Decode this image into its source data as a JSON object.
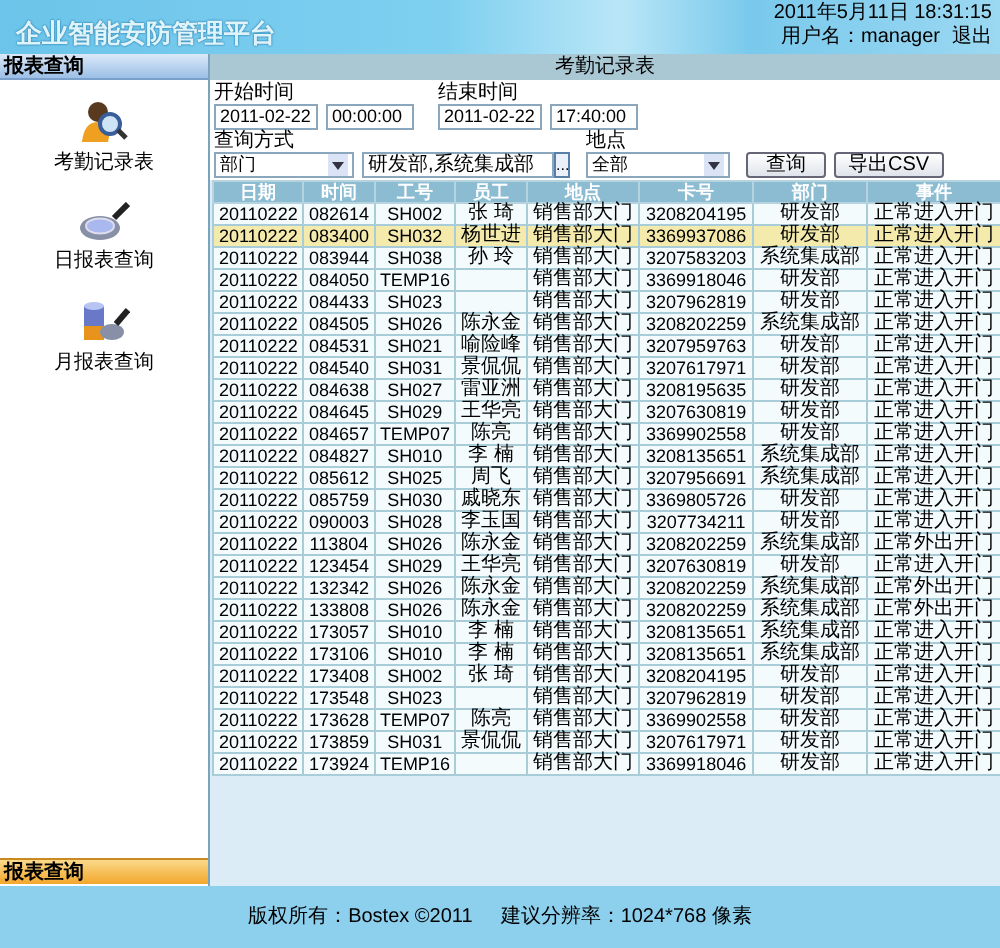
{
  "header": {
    "title": "企业智能安防管理平台",
    "datetime": "2011年5月11日  18:31:15",
    "user": "用户名：manager",
    "logout": "退出"
  },
  "sidebar": {
    "title": "报表查询",
    "items": [
      {
        "label": "考勤记录表",
        "kind": "attendance"
      },
      {
        "label": "日报表查询",
        "kind": "daily"
      },
      {
        "label": "月报表查询",
        "kind": "monthly"
      }
    ],
    "bottom_section": "报表查询"
  },
  "main": {
    "title": "考勤记录表",
    "filters": {
      "start_label": "开始时间",
      "start_date": "2011-02-22",
      "start_time": "00:00:00",
      "end_label": "结束时间",
      "end_date": "2011-02-22",
      "end_time": "17:40:00",
      "mode_label": "查询方式",
      "mode": "部门",
      "departments": "研发部,系统集成部",
      "picker_button": "...",
      "location_label": "地点",
      "location": "全部",
      "query_button": "查询",
      "export_button": "导出CSV"
    },
    "table": {
      "columns": [
        "日期",
        "时间",
        "工号",
        "员工",
        "地点",
        "卡号",
        "部门",
        "事件"
      ],
      "rows": [
        {
          "selected": false,
          "cells": [
            "20110222",
            "082614",
            "SH002",
            "张 琦",
            "销售部大门",
            "3208204195",
            "研发部",
            "正常进入开门"
          ]
        },
        {
          "selected": true,
          "cells": [
            "20110222",
            "083400",
            "SH032",
            "杨世进",
            "销售部大门",
            "3369937086",
            "研发部",
            "正常进入开门"
          ]
        },
        {
          "selected": false,
          "cells": [
            "20110222",
            "083944",
            "SH038",
            "孙 玲",
            "销售部大门",
            "3207583203",
            "系统集成部",
            "正常进入开门"
          ]
        },
        {
          "selected": false,
          "cells": [
            "20110222",
            "084050",
            "TEMP16",
            "",
            "销售部大门",
            "3369918046",
            "研发部",
            "正常进入开门"
          ]
        },
        {
          "selected": false,
          "cells": [
            "20110222",
            "084433",
            "SH023",
            "",
            "销售部大门",
            "3207962819",
            "研发部",
            "正常进入开门"
          ]
        },
        {
          "selected": false,
          "cells": [
            "20110222",
            "084505",
            "SH026",
            "陈永金",
            "销售部大门",
            "3208202259",
            "系统集成部",
            "正常进入开门"
          ]
        },
        {
          "selected": false,
          "cells": [
            "20110222",
            "084531",
            "SH021",
            "喻险峰",
            "销售部大门",
            "3207959763",
            "研发部",
            "正常进入开门"
          ]
        },
        {
          "selected": false,
          "cells": [
            "20110222",
            "084540",
            "SH031",
            "景侃侃",
            "销售部大门",
            "3207617971",
            "研发部",
            "正常进入开门"
          ]
        },
        {
          "selected": false,
          "cells": [
            "20110222",
            "084638",
            "SH027",
            "雷亚洲",
            "销售部大门",
            "3208195635",
            "研发部",
            "正常进入开门"
          ]
        },
        {
          "selected": false,
          "cells": [
            "20110222",
            "084645",
            "SH029",
            "王华亮",
            "销售部大门",
            "3207630819",
            "研发部",
            "正常进入开门"
          ]
        },
        {
          "selected": false,
          "cells": [
            "20110222",
            "084657",
            "TEMP07",
            "陈亮",
            "销售部大门",
            "3369902558",
            "研发部",
            "正常进入开门"
          ]
        },
        {
          "selected": false,
          "cells": [
            "20110222",
            "084827",
            "SH010",
            "李 楠",
            "销售部大门",
            "3208135651",
            "系统集成部",
            "正常进入开门"
          ]
        },
        {
          "selected": false,
          "cells": [
            "20110222",
            "085612",
            "SH025",
            "周飞",
            "销售部大门",
            "3207956691",
            "系统集成部",
            "正常进入开门"
          ]
        },
        {
          "selected": false,
          "cells": [
            "20110222",
            "085759",
            "SH030",
            "戚晓东",
            "销售部大门",
            "3369805726",
            "研发部",
            "正常进入开门"
          ]
        },
        {
          "selected": false,
          "cells": [
            "20110222",
            "090003",
            "SH028",
            "李玉国",
            "销售部大门",
            "3207734211",
            "研发部",
            "正常进入开门"
          ]
        },
        {
          "selected": false,
          "cells": [
            "20110222",
            "113804",
            "SH026",
            "陈永金",
            "销售部大门",
            "3208202259",
            "系统集成部",
            "正常外出开门"
          ]
        },
        {
          "selected": false,
          "cells": [
            "20110222",
            "123454",
            "SH029",
            "王华亮",
            "销售部大门",
            "3207630819",
            "研发部",
            "正常进入开门"
          ]
        },
        {
          "selected": false,
          "cells": [
            "20110222",
            "132342",
            "SH026",
            "陈永金",
            "销售部大门",
            "3208202259",
            "系统集成部",
            "正常外出开门"
          ]
        },
        {
          "selected": false,
          "cells": [
            "20110222",
            "133808",
            "SH026",
            "陈永金",
            "销售部大门",
            "3208202259",
            "系统集成部",
            "正常外出开门"
          ]
        },
        {
          "selected": false,
          "cells": [
            "20110222",
            "173057",
            "SH010",
            "李 楠",
            "销售部大门",
            "3208135651",
            "系统集成部",
            "正常进入开门"
          ]
        },
        {
          "selected": false,
          "cells": [
            "20110222",
            "173106",
            "SH010",
            "李 楠",
            "销售部大门",
            "3208135651",
            "系统集成部",
            "正常进入开门"
          ]
        },
        {
          "selected": false,
          "cells": [
            "20110222",
            "173408",
            "SH002",
            "张 琦",
            "销售部大门",
            "3208204195",
            "研发部",
            "正常进入开门"
          ]
        },
        {
          "selected": false,
          "cells": [
            "20110222",
            "173548",
            "SH023",
            "",
            "销售部大门",
            "3207962819",
            "研发部",
            "正常进入开门"
          ]
        },
        {
          "selected": false,
          "cells": [
            "20110222",
            "173628",
            "TEMP07",
            "陈亮",
            "销售部大门",
            "3369902558",
            "研发部",
            "正常进入开门"
          ]
        },
        {
          "selected": false,
          "cells": [
            "20110222",
            "173859",
            "SH031",
            "景侃侃",
            "销售部大门",
            "3207617971",
            "研发部",
            "正常进入开门"
          ]
        },
        {
          "selected": false,
          "cells": [
            "20110222",
            "173924",
            "TEMP16",
            "",
            "销售部大门",
            "3369918046",
            "研发部",
            "正常进入开门"
          ]
        }
      ]
    }
  },
  "footer": {
    "copyright": "版权所有：Bostex ©2011",
    "resolution": "建议分辨率：1024*768 像素"
  }
}
